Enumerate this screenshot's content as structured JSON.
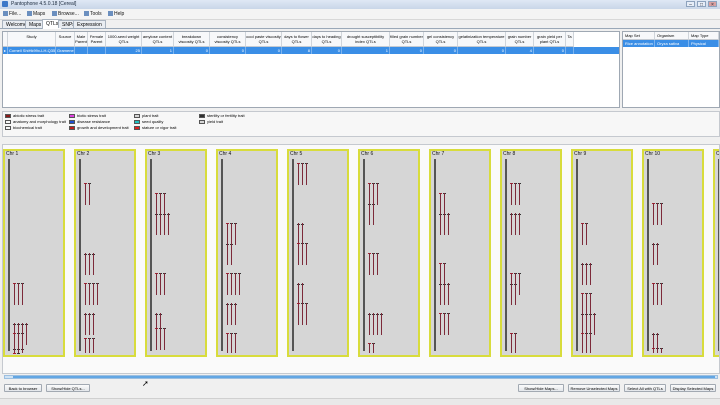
{
  "window": {
    "title": "Pantophone 4.5.0.18 [Cereal]"
  },
  "menu": [
    {
      "label": "File...",
      "icon": "file-icon"
    },
    {
      "label": "Maps",
      "icon": "map-icon"
    },
    {
      "label": "Browse...",
      "icon": "browse-icon"
    },
    {
      "label": "Tools",
      "icon": "tools-icon"
    },
    {
      "label": "Help",
      "icon": "help-icon"
    }
  ],
  "tabs": [
    "Welcome",
    "Maps",
    "QTLs",
    "SNPs",
    "Expression"
  ],
  "active_tab": "QTLs",
  "qtl_table": {
    "columns": [
      "",
      "Study",
      "Source",
      "Male Parent",
      "Female Parent",
      "1000-seed weight QTLs",
      "amylose content QTLs",
      "breakdown viscosity QTLs",
      "consistency viscosity QTLs",
      "cool paste viscosity QTLs",
      "days to flower QTLs",
      "days to heading QTLs",
      "drought susceptibility index QTLs",
      "filled grain number QTLs",
      "gel consistency QTLs",
      "gelatinization temperature QTLs",
      "grain number QTLs",
      "grain yield per plant QTLs",
      "Ta"
    ],
    "rows": [
      [
        "▸",
        "Cornell ShiHk99x-LH-Q35, 2001",
        "Gramene",
        "",
        "",
        "25",
        "1",
        "0",
        "0",
        "0",
        "8",
        "0",
        "1",
        "0",
        "0",
        "0",
        "4",
        "0",
        ""
      ]
    ]
  },
  "maps_table": {
    "columns": [
      "Map Set",
      "Organism",
      "Map Type"
    ],
    "rows": [
      [
        "Rice annotation",
        "Oryza sativa",
        "Physical"
      ]
    ]
  },
  "legend": [
    {
      "label": "abiotic stress trait",
      "color": "#8b1a1a"
    },
    {
      "label": "anatomy and morphology trait",
      "color": "#f7f7f7"
    },
    {
      "label": "biochemical trait",
      "color": "#f7f7f7"
    },
    {
      "label": "biotic stress trait",
      "color": "#e040e0"
    },
    {
      "label": "disease resistance",
      "color": "#2050d0"
    },
    {
      "label": "growth and development trait",
      "color": "#c02020"
    },
    {
      "label": "plant trait",
      "color": "#d6d6d6"
    },
    {
      "label": "seed quality",
      "color": "#20c0c0"
    },
    {
      "label": "stature or vigor trait",
      "color": "#e02020"
    },
    {
      "label": "sterility or fertility trait",
      "color": "#303030"
    },
    {
      "label": "yield trait",
      "color": "#d6d6d6"
    }
  ],
  "chromosomes": [
    "Chr 1",
    "Chr 2",
    "Chr 3",
    "Chr 4",
    "Chr 5",
    "Chr 6",
    "Chr 7",
    "Chr 8",
    "Chr 9",
    "Chr 10",
    "Chr 11"
  ],
  "buttons": {
    "back": "Back to browser",
    "show_hide_qtls": "Show/Hide QTLs...",
    "show_hide_maps": "Show/Hide Maps...",
    "remove_unselected": "Remove Unselected Maps",
    "select_all": "Select All with QTLs",
    "display_selected": "Display Selected Maps"
  }
}
